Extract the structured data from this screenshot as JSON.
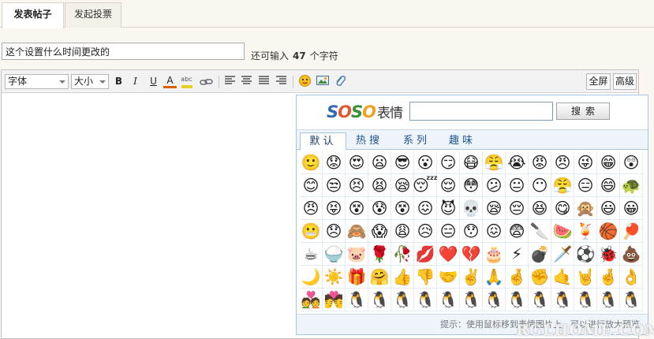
{
  "tabs": [
    {
      "label": "发表帖子",
      "active": true
    },
    {
      "label": "发起投票",
      "active": false
    }
  ],
  "subject": {
    "value": "这个设置什么时间更改的"
  },
  "counter": {
    "prefix": "还可输入",
    "count": "47",
    "suffix": "个字符"
  },
  "toolbar": {
    "font_select": "字体",
    "size_select": "大小",
    "bold": "B",
    "italic": "I",
    "underline": "U",
    "font_color": "A",
    "highlight": "abc",
    "fullscreen": "全屏",
    "advanced": "高级"
  },
  "smilies": {
    "brand": {
      "part1": "S",
      "part2": "O",
      "part3": "S",
      "part4": "O",
      "title": "表情"
    },
    "search_placeholder": "",
    "search_button": "搜索",
    "tabs": [
      "默认",
      "热搜",
      "系列",
      "趣味"
    ],
    "hint": "提示：使用鼠标移到表情图片上，可以进行放大预览",
    "grid": [
      [
        "🙂",
        "😟",
        "😍",
        "😦",
        "😎",
        "😮",
        "😏",
        "😷",
        "😤",
        "😭",
        "😡",
        "😠",
        "😜",
        "😁",
        "😲"
      ],
      [
        "😊",
        "😒",
        "😣",
        "😫",
        "😪",
        "😴",
        "😌",
        "😳",
        "😕",
        "😐",
        "😶",
        "😤",
        "😑",
        "😄",
        "🐢"
      ],
      [
        "😠",
        "😝",
        "😵",
        "😰",
        "😵",
        "😖",
        "😈",
        "💀",
        "😪",
        "😔",
        "😆",
        "😋",
        "🙊",
        "😃",
        "😀"
      ],
      [
        "😬",
        "😞",
        "🙈",
        "😱",
        "😩",
        "😥",
        "😑",
        "😯",
        "😖",
        "😨",
        "🔪",
        "🍉",
        "🍹",
        "🏀",
        "🏓"
      ],
      [
        "☕",
        "🍚",
        "🐷",
        "🌹",
        "🥀",
        "💋",
        "❤️",
        "💔",
        "🎂",
        "⚡",
        "💣",
        "🗡️",
        "⚽",
        "🐞",
        "💩"
      ],
      [
        "🌙",
        "☀️",
        "🎁",
        "🤗",
        "👍",
        "👎",
        "🤝",
        "✌️",
        "🙏",
        "🤞",
        "✊",
        "🤙",
        "🤘",
        "🤞",
        "👌"
      ],
      [
        "💑",
        "💏",
        "🐧",
        "🐧",
        "🐧",
        "🐧",
        "🐧",
        "🐧",
        "🐧",
        "🐧",
        "🐧",
        "🐧",
        "🐧",
        "🐧",
        "🐧"
      ]
    ]
  },
  "watermark": "RGLHOME.COM",
  "colors": {
    "accent": "#1e5494",
    "panel_border": "#a6c4dd",
    "font_color_bar": "#e06000"
  }
}
